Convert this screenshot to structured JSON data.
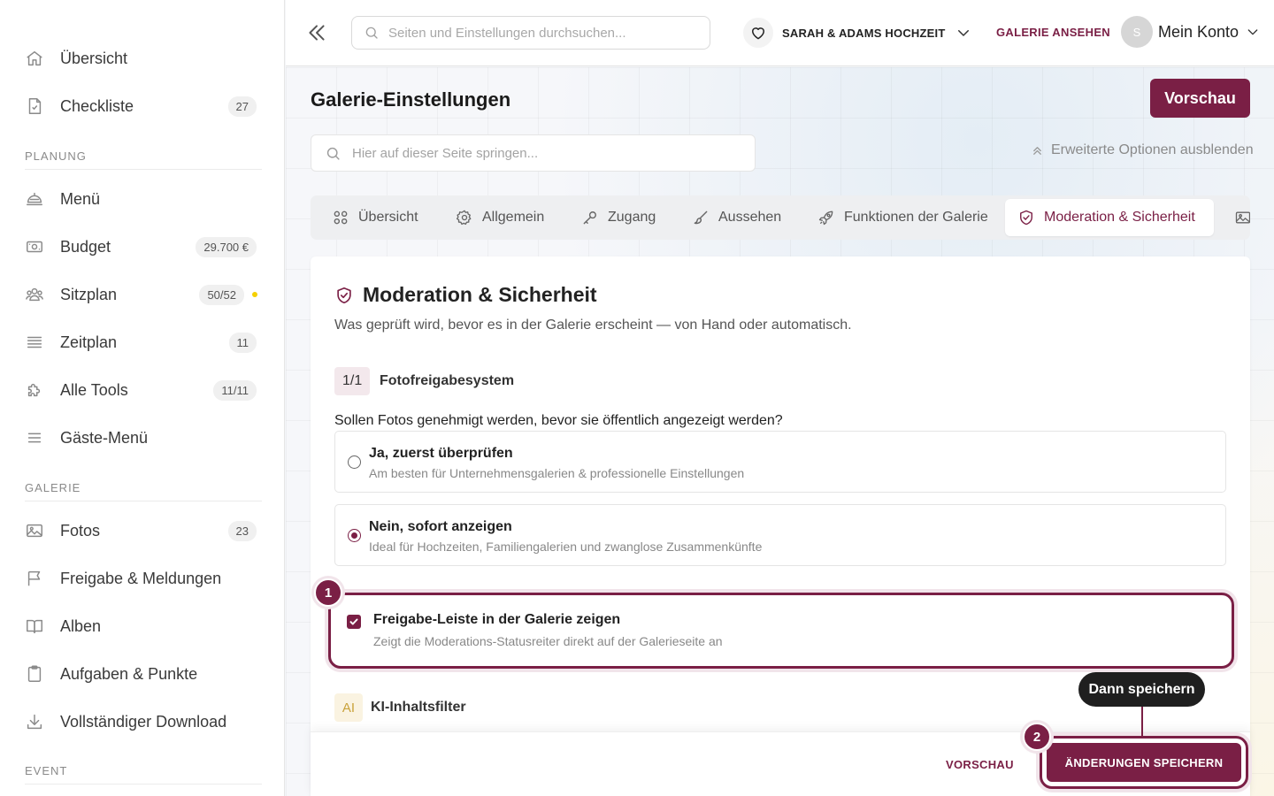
{
  "sidebar": {
    "items": [
      {
        "label": "Übersicht",
        "icon": "home-icon"
      },
      {
        "label": "Checkliste",
        "icon": "checklist-icon",
        "badge": "27"
      },
      {
        "label": "Menü",
        "icon": "cloche-icon"
      },
      {
        "label": "Budget",
        "icon": "money-icon",
        "badge": "29.700 €"
      },
      {
        "label": "Sitzplan",
        "icon": "people-icon",
        "badge": "50/52",
        "status_dot_color": "#f5d000"
      },
      {
        "label": "Zeitplan",
        "icon": "timeline-icon",
        "badge": "11"
      },
      {
        "label": "Alle Tools",
        "icon": "puzzle-icon",
        "badge": "11/11"
      },
      {
        "label": "Gäste-Menü",
        "icon": "menu-lines-icon"
      },
      {
        "label": "Fotos",
        "icon": "image-icon",
        "badge": "23"
      },
      {
        "label": "Freigabe & Meldungen",
        "icon": "flag-icon"
      },
      {
        "label": "Alben",
        "icon": "book-icon"
      },
      {
        "label": "Aufgaben & Punkte",
        "icon": "clipboard-icon"
      },
      {
        "label": "Vollständiger Download",
        "icon": "download-icon"
      }
    ],
    "sections": [
      "PLANUNG",
      "GALERIE",
      "EVENT"
    ]
  },
  "topbar": {
    "search_placeholder": "Seiten und Einstellungen durchsuchen...",
    "event_name": "SARAH & ADAMS HOCHZEIT",
    "gallery_link": "GALERIE ANSEHEN",
    "avatar_initial": "S",
    "account_label": "Mein Konto"
  },
  "main": {
    "title": "Galerie-Einstellungen",
    "preview_button": "Vorschau",
    "page_search_placeholder": "Hier auf dieser Seite springen...",
    "advanced_toggle": "Erweiterte Optionen ausblenden",
    "tabs": [
      {
        "label": "Übersicht",
        "icon": "grid-icon"
      },
      {
        "label": "Allgemein",
        "icon": "gear-icon"
      },
      {
        "label": "Zugang",
        "icon": "key-icon"
      },
      {
        "label": "Aussehen",
        "icon": "brush-icon"
      },
      {
        "label": "Funktionen der Galerie",
        "icon": "rocket-icon"
      },
      {
        "label": "Moderation & Sicherheit",
        "icon": "shield-check-icon",
        "active": true
      },
      {
        "label": "",
        "icon": "image-icon"
      }
    ]
  },
  "card": {
    "title": "Moderation & Sicherheit",
    "description": "Was geprüft wird, bevor es in der Galerie erscheint — von Hand oder automatisch.",
    "question_badge": "1/1",
    "question_group": "Fotofreigabesystem",
    "question": "Sollen Fotos genehmigt werden, bevor sie öffentlich angezeigt werden?",
    "options": [
      {
        "title": "Ja, zuerst überprüfen",
        "subtitle": "Am besten für Unternehmensgalerien & professionelle Einstellungen",
        "selected": false
      },
      {
        "title": "Nein, sofort anzeigen",
        "subtitle": "Ideal für Hochzeiten, Familiengalerien und zwanglose Zusammenkünfte",
        "selected": true
      }
    ],
    "checkbox": {
      "title": "Freigabe-Leiste in der Galerie zeigen",
      "subtitle": "Zeigt die Moderations-Statusreiter direkt auf der Galerieseite an",
      "checked": true
    },
    "ai_badge": "AI",
    "ai_label": "KI-Inhaltsfilter"
  },
  "footer": {
    "preview_label": "VORSCHAU",
    "save_label": "ÄNDERUNGEN SPEICHERN"
  },
  "guide": {
    "step1": "1",
    "step2": "2",
    "tooltip": "Dann speichern"
  },
  "colors": {
    "accent": "#7a1f45",
    "accent_soft": "#f1e4ea",
    "status_dot": "#f5d000"
  }
}
